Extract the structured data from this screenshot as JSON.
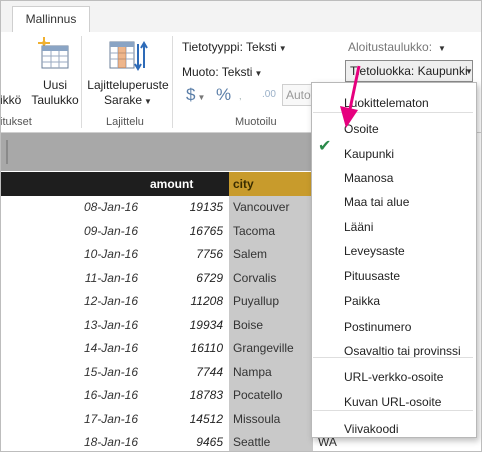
{
  "ribbon": {
    "tab_label": "Mallinnus",
    "new_table": {
      "line1": "Uusi",
      "line2": "Taulukko"
    },
    "partial_left_label": "ikkö",
    "sort_by": {
      "line1": "Lajitteluperuste",
      "line2": "Sarake"
    },
    "data_type": "Tietotyyppi: Teksti",
    "format": "Muoto: Teksti",
    "currency_symbol": "$",
    "percent_symbol": "%",
    "decimal_symbol": ".00",
    "auto_field": "Auto",
    "home_table": "Aloitustaulukko:",
    "data_category": "Tietoluokka: Kaupunki",
    "groups": {
      "left": "itukset",
      "sort": "Lajittelu",
      "formatting": "Muotoilu"
    }
  },
  "table": {
    "columns": [
      "amount",
      "city"
    ],
    "rows": [
      {
        "date": "08-Jan-16",
        "amount": "19135",
        "city": "Vancouver",
        "extra": ""
      },
      {
        "date": "09-Jan-16",
        "amount": "16765",
        "city": "Tacoma",
        "extra": ""
      },
      {
        "date": "10-Jan-16",
        "amount": "7756",
        "city": "Salem",
        "extra": ""
      },
      {
        "date": "11-Jan-16",
        "amount": "6729",
        "city": "Corvalis",
        "extra": ""
      },
      {
        "date": "12-Jan-16",
        "amount": "11208",
        "city": "Puyallup",
        "extra": ""
      },
      {
        "date": "13-Jan-16",
        "amount": "19934",
        "city": "Boise",
        "extra": ""
      },
      {
        "date": "14-Jan-16",
        "amount": "16110",
        "city": "Grangeville",
        "extra": ""
      },
      {
        "date": "15-Jan-16",
        "amount": "7744",
        "city": "Nampa",
        "extra": ""
      },
      {
        "date": "16-Jan-16",
        "amount": "18783",
        "city": "Pocatello",
        "extra": ""
      },
      {
        "date": "17-Jan-16",
        "amount": "14512",
        "city": "Missoula",
        "extra": ""
      },
      {
        "date": "18-Jan-16",
        "amount": "9465",
        "city": "Seattle",
        "extra": "WA"
      }
    ]
  },
  "menu": {
    "selected": "Kaupunki",
    "groups": [
      [
        "Luokittelematon"
      ],
      [
        "Osoite",
        "Kaupunki",
        "Maanosa",
        "Maa tai alue",
        "Lääni",
        "Leveysaste",
        "Pituusaste",
        "Paikka",
        "Postinumero",
        "Osavaltio tai provinssi"
      ],
      [
        "URL-verkko-osoite",
        "Kuvan URL-osoite"
      ],
      [
        "Viivakoodi"
      ]
    ]
  },
  "colors": {
    "city_header": "#c89b2c",
    "header_bar": "#1e1e1e",
    "arrow": "#e6007e",
    "check": "#2a8a4a"
  }
}
